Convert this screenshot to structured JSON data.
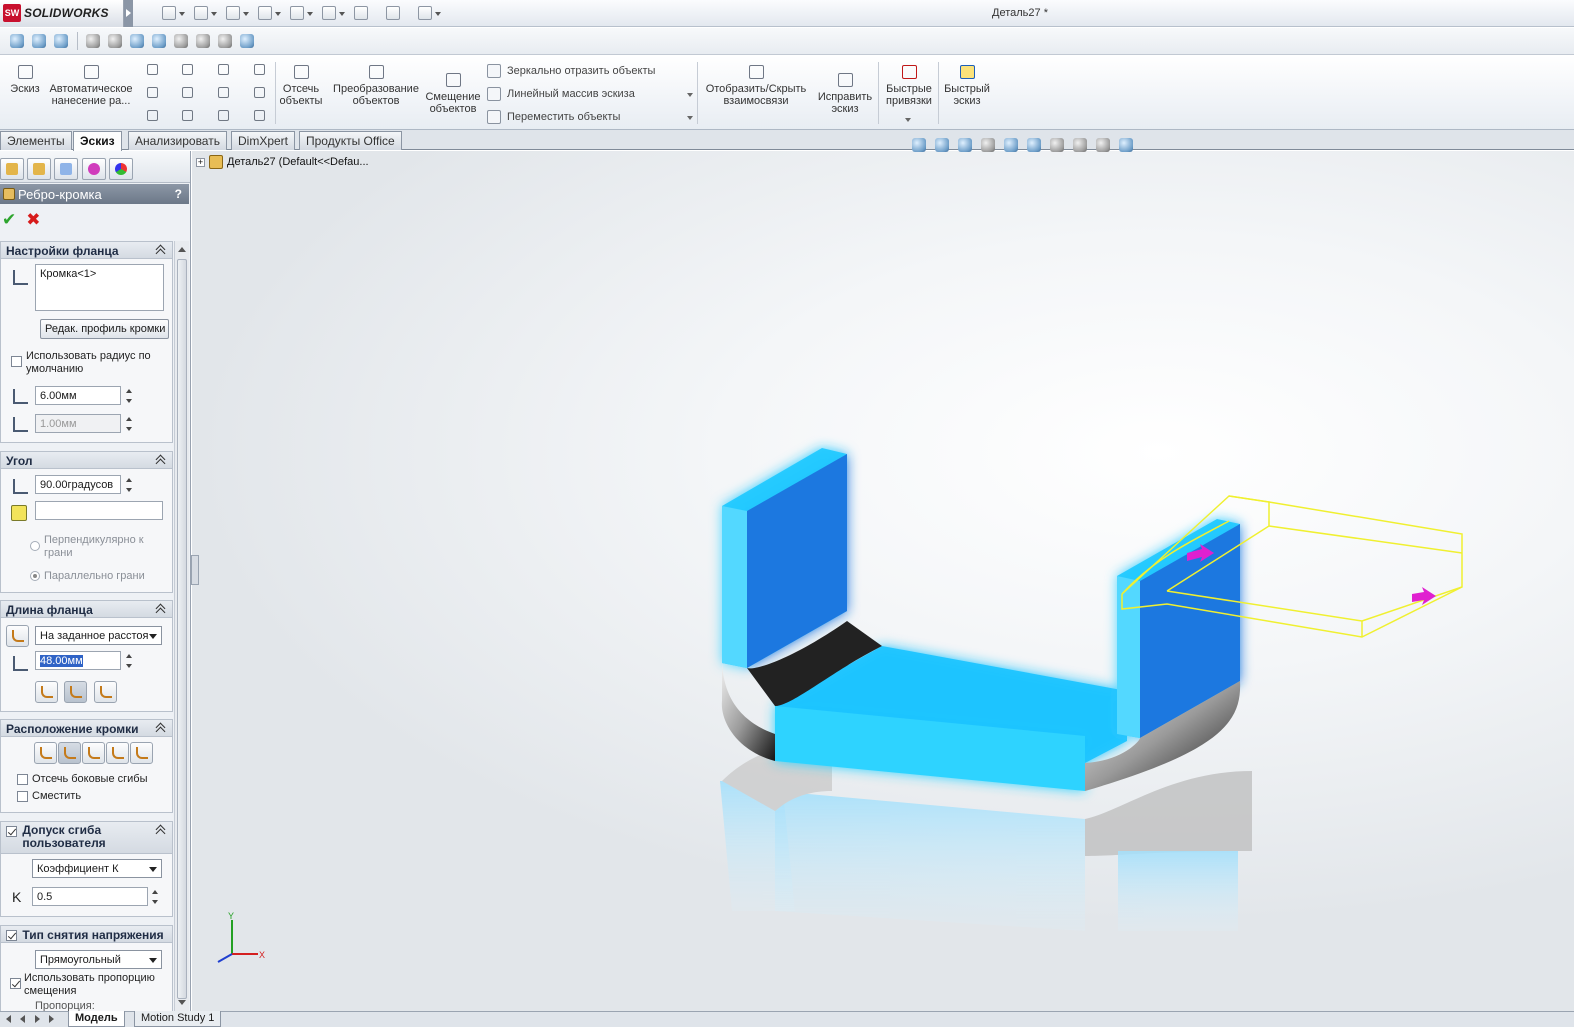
{
  "app": {
    "logo_text": "SOLIDWORKS",
    "logo_badge": "SW",
    "document_title": "Деталь27 *"
  },
  "toolbar": {
    "sketch": "Эскиз",
    "smart_dimension": "Автоматическое нанесение ра...",
    "trim": "Отсечь объекты",
    "convert": "Преобразование объектов",
    "offset": "Смещение объектов",
    "mirror": "Зеркально отразить объекты",
    "linear_pattern": "Линейный массив эскиза",
    "move": "Переместить объекты",
    "relations": "Отобразить/Скрыть взаимосвязи",
    "repair": "Исправить эскиз",
    "quick_snaps": "Быстрые привязки",
    "rapid_sketch": "Быстрый эскиз"
  },
  "tabs": [
    "Элементы",
    "Эскиз",
    "Анализировать",
    "DimXpert",
    "Продукты Office"
  ],
  "active_tab": "Эскиз",
  "feature_tree": {
    "root": "Деталь27  (Default<<Defau..."
  },
  "panel": {
    "title": "Ребро-кромка",
    "help": "?",
    "ok": "✔",
    "cancel": "✖",
    "flange_params": {
      "header": "Настройки фланца",
      "edge_item": "Кромка<1>",
      "edit_profile_button": "Редак. профиль кромки",
      "use_default_radius": "Использовать радиус по умолчанию",
      "radius": "6.00мм",
      "gap": "1.00мм"
    },
    "angle": {
      "header": "Угол",
      "value": "90.00градусов",
      "face_field": "",
      "perpendicular": "Перпендикулярно к грани",
      "parallel": "Параллельно грани"
    },
    "flange_length": {
      "header": "Длина фланца",
      "end_condition": "На заданное расстоя",
      "length": "48.00мм"
    },
    "flange_position": {
      "header": "Расположение кромки",
      "trim_side_bends": "Отсечь боковые сгибы",
      "offset": "Сместить"
    },
    "bend_allowance": {
      "header": "Допуск сгиба пользователя",
      "type": "Коэффициент К",
      "k_label": "K",
      "k_value": "0.5"
    },
    "relief": {
      "header": "Тип снятия напряжения",
      "type": "Прямоугольный",
      "use_ratio": "Использовать пропорцию смещения",
      "ratio_label": "Пропорция:"
    }
  },
  "bottom_tabs": [
    "Модель",
    "Motion Study 1"
  ],
  "triad": {
    "x": "X",
    "y": "Y"
  },
  "colors": {
    "accent_blue": "#1fc4ff",
    "preview_yellow": "#f0f030",
    "handle_magenta": "#e020d0",
    "panel_title": "#7b8696"
  }
}
